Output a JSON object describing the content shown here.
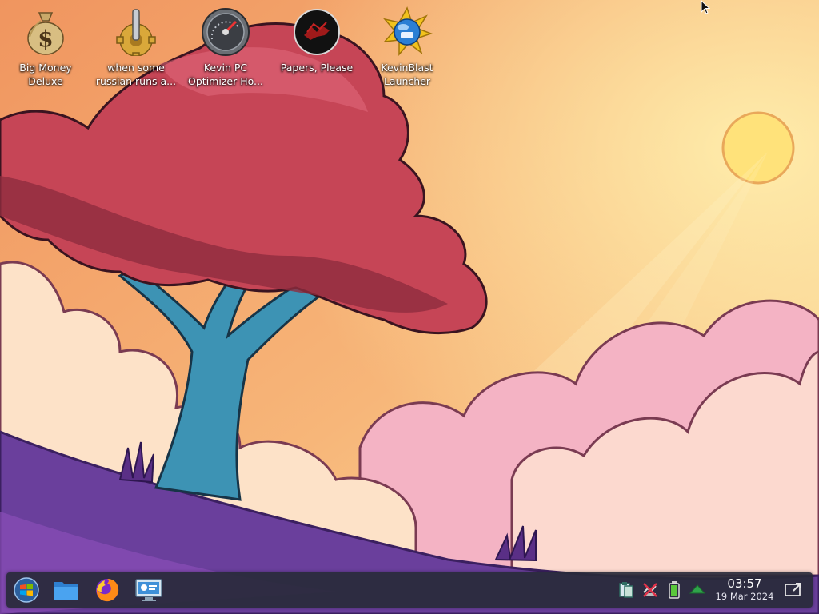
{
  "desktop": {
    "icons": [
      {
        "label": "Big Money\nDeluxe",
        "icon": "money-bag-icon"
      },
      {
        "label": "when some\nrussian runs a...",
        "icon": "gear-lever-icon"
      },
      {
        "label": "Kevin PC\nOptimizer Ho...",
        "icon": "speedometer-icon"
      },
      {
        "label": "Papers, Please",
        "icon": "eagle-emblem-icon"
      },
      {
        "label": "KevinBlast\nLauncher",
        "icon": "globe-star-icon"
      }
    ]
  },
  "taskbar": {
    "pinned": [
      {
        "name": "start-menu",
        "icon": "windows-orb-icon"
      },
      {
        "name": "file-manager",
        "icon": "folder-icon"
      },
      {
        "name": "firefox",
        "icon": "firefox-icon"
      },
      {
        "name": "system-settings",
        "icon": "monitor-settings-icon"
      }
    ],
    "tray": [
      {
        "name": "clipboard",
        "icon": "clipboard-icon"
      },
      {
        "name": "network",
        "icon": "network-disconnected-icon"
      },
      {
        "name": "battery",
        "icon": "battery-icon"
      },
      {
        "name": "updates",
        "icon": "arrow-up-icon"
      }
    ],
    "clock": {
      "time": "03:57",
      "date": "19 Mar 2024"
    },
    "show_desktop_icon": "show-desktop-icon"
  },
  "colors": {
    "taskbar_bg": "#282a3a",
    "sky_top": "#f29a66",
    "sky_bottom": "#f8d48a",
    "tree_foliage": "#c94555",
    "trunk": "#3a8fb0",
    "hill": "#6a3f9c"
  }
}
